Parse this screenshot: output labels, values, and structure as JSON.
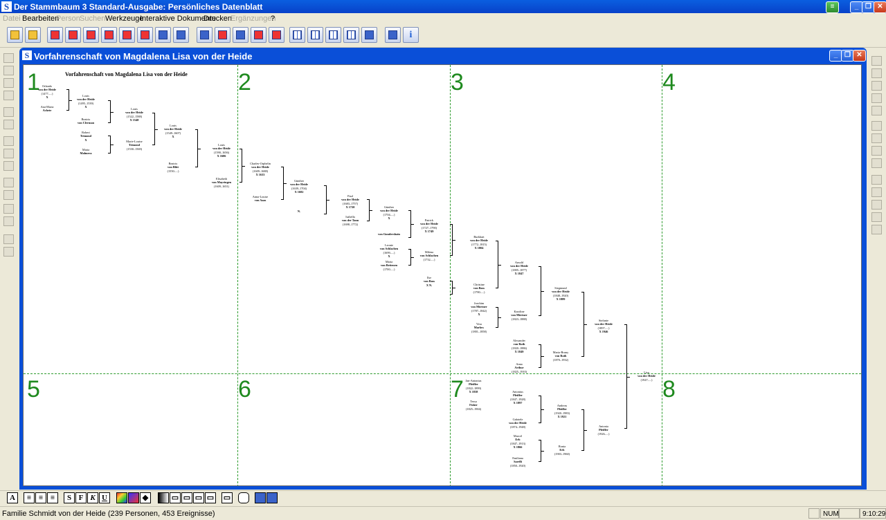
{
  "app": {
    "title": "Der Stammbaum 3 Standard-Ausgabe: Persönliches Datenblatt",
    "icon_letter": "S",
    "window_buttons": [
      "minimize",
      "restore",
      "close"
    ]
  },
  "menu": [
    {
      "label": "Datei",
      "enabled": false
    },
    {
      "label": "Bearbeiten",
      "enabled": true
    },
    {
      "label": "Person",
      "enabled": false
    },
    {
      "label": "Suchen",
      "enabled": false
    },
    {
      "label": "Werkzeuge",
      "enabled": true
    },
    {
      "label": "Interaktive Dokumente",
      "enabled": true
    },
    {
      "label": "Drucken",
      "enabled": true
    },
    {
      "label": "Ergänzungen",
      "enabled": false
    },
    {
      "label": "?",
      "enabled": true
    }
  ],
  "document": {
    "window_title": "Vorfahrenschaft von Magdalena Lisa von der Heide",
    "chart_title": "Vorfahrenschaft von Magdalena Lisa von der Heide",
    "page_numbers": [
      "1",
      "2",
      "3",
      "4",
      "5",
      "6",
      "7",
      "8"
    ],
    "persons": [
      {
        "name": "Orlando",
        "surname": "von der Heide",
        "dates": "(1477–...)",
        "marker": "X"
      },
      {
        "name": "Ana-Maria",
        "surname": "Achete",
        "dates": "",
        "marker": ""
      },
      {
        "name": "Louis",
        "surname": "von der Heide",
        "dates": "(1495–1539)",
        "marker": "X"
      },
      {
        "name": "Beatrix",
        "surname": "von Clerman",
        "dates": "",
        "marker": ""
      },
      {
        "name": "Robert",
        "surname": "Trimond",
        "dates": "",
        "marker": "X"
      },
      {
        "name": "Maria",
        "surname": "Malmera",
        "dates": "",
        "marker": ""
      },
      {
        "name": "Louis",
        "surname": "von der Heide",
        "dates": "(1522–1588)",
        "marker": "X 1548"
      },
      {
        "name": "Marie-Louise",
        "surname": "Trimond",
        "dates": "(1530–1569)",
        "marker": ""
      },
      {
        "name": "Louis",
        "surname": "von der Heide",
        "dates": "(1549–1607)",
        "marker": "X"
      },
      {
        "name": "Beatrix",
        "surname": "von Blitt",
        "dates": "(1550–...)",
        "marker": ""
      },
      {
        "name": "Louis",
        "surname": "von der Heide",
        "dates": "(1590–1656)",
        "marker": "X 1606"
      },
      {
        "name": "Elisabeth",
        "surname": "von Mayringen",
        "dates": "(1609–1651)",
        "marker": ""
      },
      {
        "name": "Charles-Orphelin",
        "surname": "von der Heide",
        "dates": "(1609–1688)",
        "marker": "X 1633"
      },
      {
        "name": "Anna-Louise",
        "surname": "von Aaas",
        "dates": "",
        "marker": ""
      },
      {
        "name": "Günther",
        "surname": "von der Heide",
        "dates": "(1639–1704)",
        "marker": "X 1682"
      },
      {
        "name": "",
        "surname": "",
        "dates": "",
        "marker": "N."
      },
      {
        "name": "Paul",
        "surname": "von der Heide",
        "dates": "(1683–1757)",
        "marker": "X 1720"
      },
      {
        "name": "Isabella",
        "surname": "von der Tann",
        "dates": "(1698–1772)",
        "marker": ""
      },
      {
        "name": "Günther",
        "surname": "von der Heide",
        "dates": "(1704–...)",
        "marker": "X"
      },
      {
        "name": "",
        "surname": "von Gundershain",
        "dates": "",
        "marker": ""
      },
      {
        "name": "Leonie",
        "surname": "von Schlachen",
        "dates": "(1699–...)",
        "marker": "X"
      },
      {
        "name": "Maria",
        "surname": "von Bettenen",
        "dates": "(1700–...)",
        "marker": ""
      },
      {
        "name": "Patrick",
        "surname": "von der Heide",
        "dates": "(1727–1790)",
        "marker": "X 1749"
      },
      {
        "name": "Milena",
        "surname": "von Schlachen",
        "dates": "(1732–...)",
        "marker": ""
      },
      {
        "name": "Ilse",
        "surname": "von Bass",
        "dates": "",
        "marker": "X N."
      },
      {
        "name": "Burkhart",
        "surname": "von der Heide",
        "dates": "(1772–1815)",
        "marker": "X 1804"
      },
      {
        "name": "Christine",
        "surname": "von Bass",
        "dates": "(1780–...)",
        "marker": ""
      },
      {
        "name": "Joachim",
        "surname": "von Mörtner",
        "dates": "(1787–1842)",
        "marker": "X"
      },
      {
        "name": "Vera",
        "surname": "Marlow",
        "dates": "(1801–1858)",
        "marker": ""
      },
      {
        "name": "Arnold",
        "surname": "von der Heide",
        "dates": "(1805–1877)",
        "marker": "X 1847"
      },
      {
        "name": "Karoline",
        "surname": "von Mörtner",
        "dates": "(1823–1888)",
        "marker": ""
      },
      {
        "name": "Siegmund",
        "surname": "von der Heide",
        "dates": "(1848–1920)",
        "marker": "X 1889"
      },
      {
        "name": "Alexander",
        "surname": "von Roth",
        "dates": "(1820–1886)",
        "marker": "X 1849"
      },
      {
        "name": "Anna",
        "surname": "Arthur",
        "dates": "(1825–1910)",
        "marker": ""
      },
      {
        "name": "Maria-Bruny",
        "surname": "von Roth",
        "dates": "(1870–1932)",
        "marker": ""
      },
      {
        "name": "Stefanie",
        "surname": "von der Heide",
        "dates": "(1897–...)",
        "marker": "X 1946"
      },
      {
        "name": "Lisa",
        "surname": "von der Heide",
        "dates": "(1947–...)",
        "marker": ""
      },
      {
        "name": "Jan-Antonius",
        "surname": "Pfeiffer",
        "dates": "(1822–1899)",
        "marker": "X 1838"
      },
      {
        "name": "Tessa",
        "surname": "Fisher",
        "dates": "(1825–1904)",
        "marker": ""
      },
      {
        "name": "Antonius",
        "surname": "Pfeiffer",
        "dates": "(1847–1928)",
        "marker": "X 1897"
      },
      {
        "name": "Gabriele",
        "surname": "von der Heide",
        "dates": "(1874–1948)",
        "marker": ""
      },
      {
        "name": "Andreas",
        "surname": "Pfeiffer",
        "dates": "(1920–1983)",
        "marker": "X 1921"
      },
      {
        "name": "Marcel",
        "surname": "Erb",
        "dates": "(1847–1913)",
        "marker": "X 1866"
      },
      {
        "name": "Emiliana",
        "surname": "Sarelli",
        "dates": "(1850–1920)",
        "marker": ""
      },
      {
        "name": "Ronia",
        "surname": "Erb",
        "dates": "(1903–1960)",
        "marker": ""
      },
      {
        "name": "Antonia",
        "surname": "Pfeiffer",
        "dates": "(1926–...)",
        "marker": ""
      }
    ]
  },
  "status": {
    "text": "Familie Schmidt von der Heide (239 Personen, 453 Ereignisse)",
    "num": "NUM",
    "time": "9:10:29"
  },
  "colors": {
    "titlebar": "#0a5fe0",
    "page_number": "#1f8a1f",
    "page_grid": "#2a9a2a",
    "window_bg": "#ece9d8"
  },
  "icons": {
    "toolbar": [
      "open-folder-icon",
      "open-folder-icon",
      "person-card-icon",
      "person-card-icon",
      "person-delete-icon",
      "family-icon",
      "family-icon",
      "family-icon",
      "family-icon",
      "trash-icon",
      "layout-icon",
      "layout-icon",
      "page-icon",
      "page-icon",
      "zoom-icon",
      "grid-icon",
      "grid-icon",
      "grid-icon",
      "grid-icon",
      "brush-icon",
      "chart-icon",
      "info-icon"
    ],
    "format": [
      "text-a-icon",
      "align-left-icon",
      "align-center-icon",
      "align-right-icon",
      "bold-s-icon",
      "bold-f-icon",
      "italic-k-icon",
      "underline-u-icon",
      "color-icon",
      "fill-icon",
      "frame-icon",
      "frame-icon",
      "frame-icon",
      "frame-icon",
      "frame-icon",
      "rounded-frame-icon",
      "window-icon",
      "window-icon"
    ]
  }
}
